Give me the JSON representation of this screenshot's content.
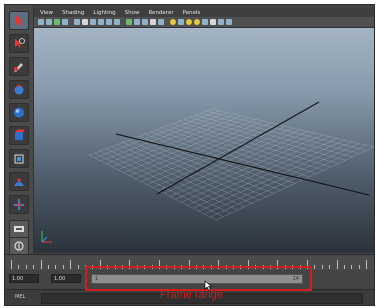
{
  "menubar": {
    "items": [
      "View",
      "Shading",
      "Lighting",
      "Show",
      "Renderer",
      "Panels"
    ]
  },
  "toolbox": {
    "tools": [
      "select-tool",
      "lasso-tool",
      "paint-select-tool",
      "move-tool",
      "rotate-tool",
      "scale-tool",
      "universal-manipulator",
      "soft-mod-tool",
      "show-manipulator"
    ]
  },
  "range_slider": {
    "start_time": "1.00",
    "playback_start": "1.00",
    "range_start_label": "1",
    "range_end_label": "24"
  },
  "command_line": {
    "label": "MEL"
  },
  "annotation": {
    "label": "Frame range",
    "color": "#d21e1e"
  },
  "colors": {
    "accent": "#d21e1e",
    "grid": "#c4cfda",
    "axis_line": "#111111"
  }
}
